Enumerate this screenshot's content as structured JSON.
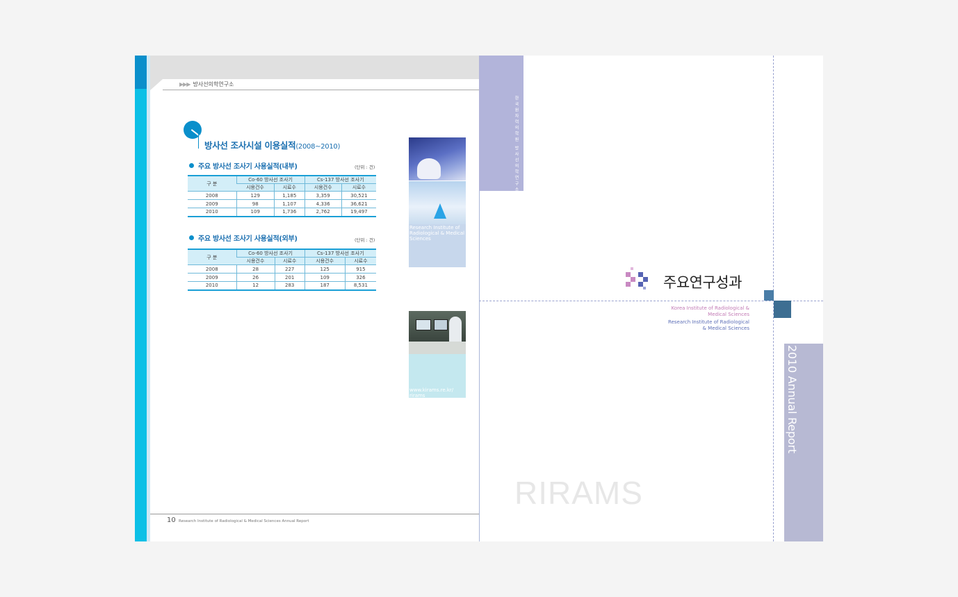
{
  "left_page": {
    "breadcrumb_arrows": "▶▶▶",
    "breadcrumb": "방사선의학연구소",
    "section_title": "방사선 조사시설 이용실적",
    "section_years": "(2008~2010)",
    "tables": [
      {
        "title": "주요 방사선 조사기 사용실적(내부)",
        "unit": "(단위 : 건)",
        "row_header": "구  분",
        "groups": [
          "Co-60 방사선 조사기",
          "Cs-137 방사선 조사기"
        ],
        "cols": [
          "시용건수",
          "시료수",
          "시용건수",
          "시료수"
        ],
        "rows": [
          [
            "2008",
            "129",
            "1,185",
            "3,359",
            "30,521"
          ],
          [
            "2009",
            "98",
            "1,107",
            "4,336",
            "36,621"
          ],
          [
            "2010",
            "109",
            "1,736",
            "2,762",
            "19,497"
          ]
        ]
      },
      {
        "title": "주요 방사선 조사기 사용실적(외부)",
        "unit": "(단위 : 건)",
        "row_header": "구  분",
        "groups": [
          "Co-60 방사선 조사기",
          "Cs-137 방사선 조사기"
        ],
        "cols": [
          "시용건수",
          "시료수",
          "시용건수",
          "시료수"
        ],
        "rows": [
          [
            "2008",
            "28",
            "227",
            "125",
            "915"
          ],
          [
            "2009",
            "26",
            "201",
            "109",
            "326"
          ],
          [
            "2010",
            "12",
            "283",
            "187",
            "8,531"
          ]
        ]
      }
    ],
    "photo_caption": "Research Institute of Radiological & Medical Sciences",
    "url": "www.kirams.re.kr/ rirams",
    "page_number": "10",
    "footer_text": "Research Institute of Radiological & Medical Sciences Annual Report"
  },
  "right_page": {
    "vertical_label": "한국원자력의학원 방사선의학연구소",
    "main_title": "주요연구성과",
    "english_lines_pink": [
      "Korea Institute of Radiological &",
      "Medical Sciences"
    ],
    "english_lines_blue": [
      "Research Institute of Radiological",
      "& Medical Sciences"
    ],
    "annual_report": "2010 Annual Report",
    "watermark": "RIRAMS"
  },
  "colors": {
    "cyan": "#0cc0e6",
    "blue": "#0a8fcb",
    "lavender": "#b2b4da",
    "pink": "#c27ab5",
    "navy": "#3d6e92"
  }
}
